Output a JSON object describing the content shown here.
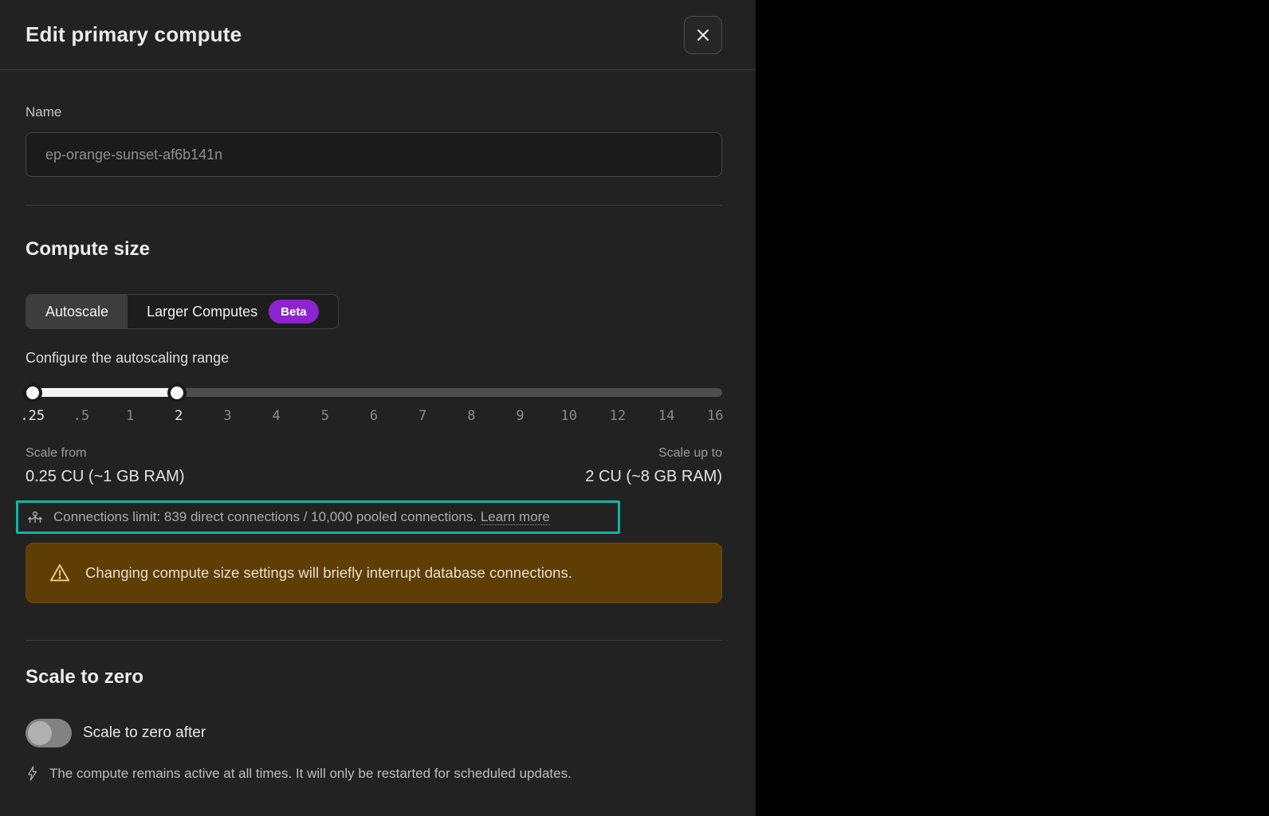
{
  "header": {
    "title": "Edit primary compute"
  },
  "name_section": {
    "label": "Name",
    "placeholder": "ep-orange-sunset-af6b141n"
  },
  "compute_size": {
    "heading": "Compute size",
    "tabs": [
      {
        "label": "Autoscale",
        "selected": true
      },
      {
        "label": "Larger Computes",
        "badge": "Beta",
        "selected": false
      }
    ],
    "slider": {
      "label": "Configure the autoscaling range",
      "ticks": [
        {
          "label": ".25",
          "active": true
        },
        {
          "label": ".5",
          "active": false
        },
        {
          "label": "1",
          "active": false
        },
        {
          "label": "2",
          "active": true
        },
        {
          "label": "3",
          "active": false
        },
        {
          "label": "4",
          "active": false
        },
        {
          "label": "5",
          "active": false
        },
        {
          "label": "6",
          "active": false
        },
        {
          "label": "7",
          "active": false
        },
        {
          "label": "8",
          "active": false
        },
        {
          "label": "9",
          "active": false
        },
        {
          "label": "10",
          "active": false
        },
        {
          "label": "12",
          "active": false
        },
        {
          "label": "14",
          "active": false
        },
        {
          "label": "16",
          "active": false
        }
      ],
      "range": {
        "from_pct": 1,
        "to_pct": 21.7
      }
    },
    "scale_from": {
      "label": "Scale from",
      "value": "0.25 CU (~1 GB RAM)"
    },
    "scale_up_to": {
      "label": "Scale up to",
      "value": "2 CU (~8 GB RAM)"
    },
    "connections_note": {
      "text": "Connections limit: 839 direct connections / 10,000 pooled connections.",
      "link": "Learn more"
    },
    "warning": {
      "text": "Changing compute size settings will briefly interrupt database connections."
    }
  },
  "scale_to_zero": {
    "heading": "Scale to zero",
    "toggle_label": "Scale to zero after",
    "toggle_on": false,
    "note": "The compute remains active at all times. It will only be restarted for scheduled updates."
  },
  "colors": {
    "highlight_teal": "#10b5a3",
    "warning_bg": "#5e3e05",
    "warning_icon": "#f2c87f",
    "beta_badge": "#8c24cf"
  }
}
